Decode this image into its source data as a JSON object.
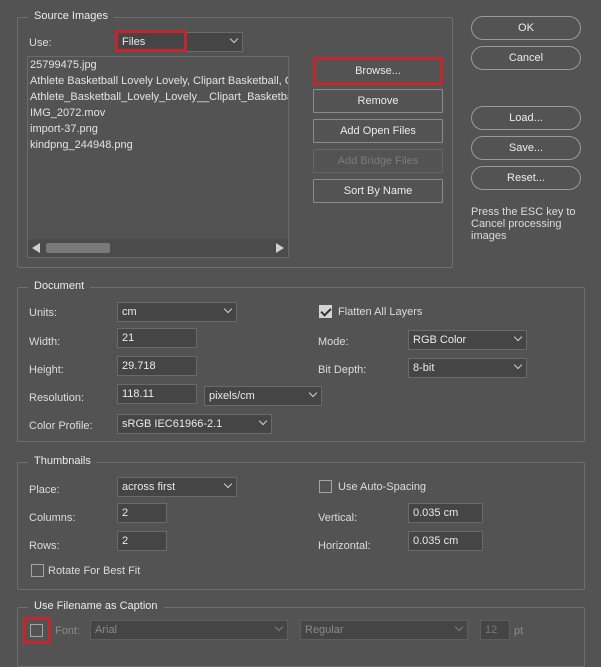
{
  "source": {
    "legend": "Source Images",
    "use_label": "Use:",
    "use_value": "Files",
    "files": [
      "25799475.jpg",
      "Athlete Basketball Lovely Lovely, Clipart Basketball, C",
      "Athlete_Basketball_Lovely_Lovely__Clipart_Basketbal",
      "IMG_2072.mov",
      "import-37.png",
      "kindpng_244948.png"
    ],
    "buttons": {
      "browse": "Browse...",
      "remove": "Remove",
      "add_open": "Add Open Files",
      "add_bridge": "Add Bridge Files",
      "sort": "Sort By Name"
    }
  },
  "side": {
    "ok": "OK",
    "cancel": "Cancel",
    "load": "Load...",
    "save": "Save...",
    "reset": "Reset...",
    "esc_note": "Press the ESC key to Cancel processing images"
  },
  "document": {
    "legend": "Document",
    "units_label": "Units:",
    "units_value": "cm",
    "width_label": "Width:",
    "width_value": "21",
    "height_label": "Height:",
    "height_value": "29.718",
    "resolution_label": "Resolution:",
    "resolution_value": "118.11",
    "resolution_unit": "pixels/cm",
    "profile_label": "Color Profile:",
    "profile_value": "sRGB IEC61966-2.1",
    "flatten_label": "Flatten All Layers",
    "flatten_checked": true,
    "mode_label": "Mode:",
    "mode_value": "RGB Color",
    "depth_label": "Bit Depth:",
    "depth_value": "8-bit"
  },
  "thumbnails": {
    "legend": "Thumbnails",
    "place_label": "Place:",
    "place_value": "across first",
    "columns_label": "Columns:",
    "columns_value": "2",
    "rows_label": "Rows:",
    "rows_value": "2",
    "rotate_label": "Rotate For Best Fit",
    "autospacing_label": "Use Auto-Spacing",
    "vertical_label": "Vertical:",
    "vertical_value": "0.035 cm",
    "horizontal_label": "Horizontal:",
    "horizontal_value": "0.035 cm"
  },
  "caption": {
    "legend": "Use Filename as Caption",
    "font_label": "Font:",
    "font_value": "Arial",
    "style_value": "Regular",
    "size_value": "12",
    "size_unit": "pt"
  },
  "colors": {
    "background": "#535353",
    "highlight": "#c1272d"
  }
}
